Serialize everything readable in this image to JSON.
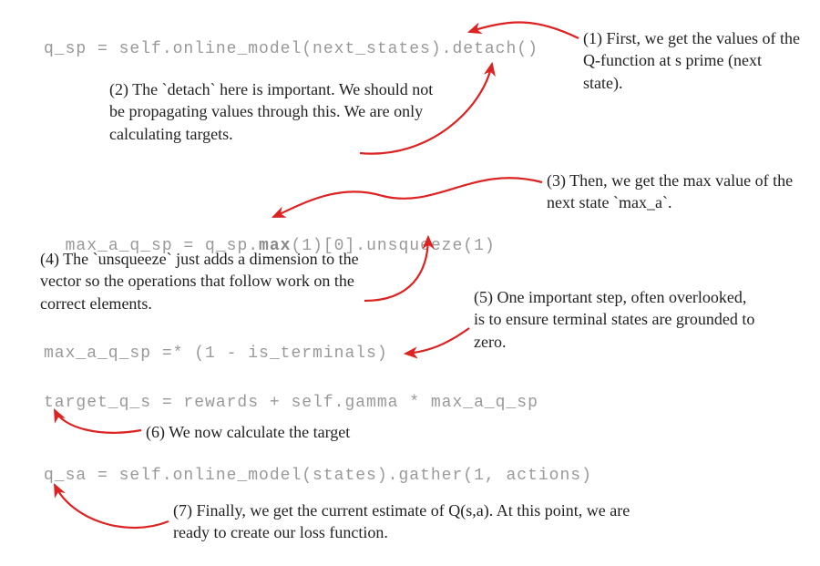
{
  "code": {
    "line1": "q_sp = self.online_model(next_states).detach()",
    "line2": "max_a_q_sp = q_sp.max(1)[0].unsqueeze(1)",
    "line2_pre": "max_a_q_sp = q_sp.",
    "line2_bold": "max",
    "line2_post": "(1)[0].unsqueeze(1)",
    "line3": "max_a_q_sp =* (1 - is_terminals)",
    "line4": "target_q_s = rewards + self.gamma * max_a_q_sp",
    "line5": "q_sa = self.online_model(states).gather(1, actions)"
  },
  "annotations": {
    "a1": "(1) First, we get the values of the Q-function at s prime (next state).",
    "a2": "(2) The `detach` here is important. We should not be propagating values through this. We are only calculating targets.",
    "a3": "(3) Then, we get the max value of the next state `max_a`.",
    "a4": "(4) The `unsqueeze` just adds a dimension to the vector so the operations that follow work on the correct elements.",
    "a5": "(5) One important step, often overlooked, is to ensure terminal states are grounded to zero.",
    "a6": "(6) We now calculate the target",
    "a7": "(7) Finally, we get the current estimate of Q(s,a). At this point, we are ready to create our loss function."
  }
}
